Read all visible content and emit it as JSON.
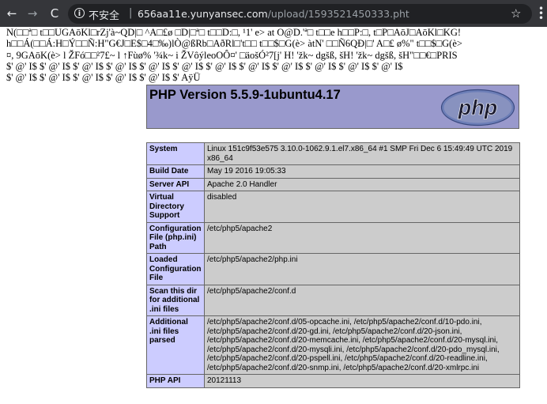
{
  "browser": {
    "back_icon": "←",
    "forward_icon": "→",
    "reload_icon": "C",
    "info_icon": "i",
    "security_label": "不安全",
    "separator": "|",
    "url_host": "656aa11e.yunyansec.com",
    "url_path": "/upload/1593521450333.pht",
    "star_icon": "☆"
  },
  "garbage_lines": [
    "N(□□ª□ t□□UGAōKl□rZj'à~QD|□ ^A□£ø □D|□ª□ t□□D:□, ¹1' e> at O@D.'ª□ t□□e h□□P:□, t□P□AōJ□AōKl□KG!",
    "h□□Á(□□Á:H□Ý□□Ñ:H\"G€J□E$□4□‰)lÒ@ßRb□AðRl□'t□□ t□□$□G(è> àtN'  □□Ñ6QĐ|□'  A□£ ø%\"  t□□$□G(è>",
    "¤, 9GAōK(è> l ŽFó□□²7£~ l ↑Fùø%  '¾k~ i ŽVôýleoOÔ¤'  □äošÓ²7[j'  H!  'žk~ dgšß, šH!  'žk~ dgšß, šH\"□□€□PRIS",
    "$' @' I$ $' @' I$ $' @' I$ $' @' I$ $' @' I$ $' @' I$ $' @' I$ $' @' I$ $' @' I$ $' @' I$ $' @' I$ $' @' I$",
    "$' @' I$ $' @' I$ $' @' I$ $' @' I$ $' @' I$ $'  AÿÜ"
  ],
  "phpinfo": {
    "title": "PHP Version 5.5.9-1ubuntu4.17",
    "logo_text": "php",
    "rows": [
      {
        "key": "System",
        "value": "Linux 151c9f53e575 3.10.0-1062.9.1.el7.x86_64 #1 SMP Fri Dec 6 15:49:49 UTC 2019 x86_64"
      },
      {
        "key": "Build Date",
        "value": "May 19 2016 19:05:33"
      },
      {
        "key": "Server API",
        "value": "Apache 2.0 Handler"
      },
      {
        "key": "Virtual Directory Support",
        "value": "disabled"
      },
      {
        "key": "Configuration File (php.ini) Path",
        "value": "/etc/php5/apache2"
      },
      {
        "key": "Loaded Configuration File",
        "value": "/etc/php5/apache2/php.ini"
      },
      {
        "key": "Scan this dir for additional .ini files",
        "value": "/etc/php5/apache2/conf.d"
      },
      {
        "key": "Additional .ini files parsed",
        "value": "/etc/php5/apache2/conf.d/05-opcache.ini, /etc/php5/apache2/conf.d/10-pdo.ini, /etc/php5/apache2/conf.d/20-gd.ini, /etc/php5/apache2/conf.d/20-json.ini, /etc/php5/apache2/conf.d/20-memcache.ini, /etc/php5/apache2/conf.d/20-mysql.ini, /etc/php5/apache2/conf.d/20-mysqli.ini, /etc/php5/apache2/conf.d/20-pdo_mysql.ini, /etc/php5/apache2/conf.d/20-pspell.ini, /etc/php5/apache2/conf.d/20-readline.ini, /etc/php5/apache2/conf.d/20-snmp.ini, /etc/php5/apache2/conf.d/20-xmlrpc.ini"
      },
      {
        "key": "PHP API",
        "value": "20121113"
      }
    ]
  },
  "colors": {
    "chrome_bg": "#35363a",
    "omnibox_bg": "#202124",
    "php_header": "#9999cc",
    "key_cell": "#ccccff",
    "value_cell": "#cccccc"
  }
}
